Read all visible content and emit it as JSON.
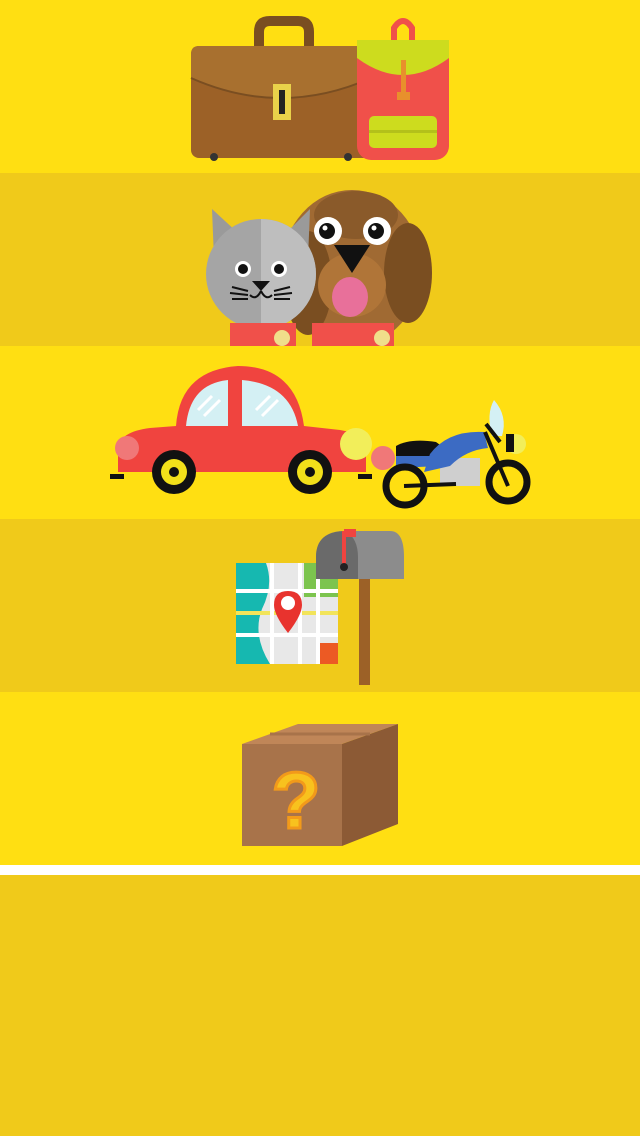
{
  "colors": {
    "row_light": "#FFDF12",
    "row_dark": "#F0CA1A",
    "filler": "#F0CA1A"
  },
  "categories": [
    {
      "id": "luggage",
      "icons": [
        "briefcase-icon",
        "backpack-icon"
      ]
    },
    {
      "id": "pets",
      "icons": [
        "cat-icon",
        "dog-icon"
      ]
    },
    {
      "id": "vehicles",
      "icons": [
        "car-icon",
        "motorcycle-icon"
      ]
    },
    {
      "id": "address",
      "icons": [
        "map-icon",
        "mailbox-icon"
      ]
    },
    {
      "id": "other",
      "icons": [
        "mystery-box-icon"
      ],
      "mark": "?"
    }
  ]
}
